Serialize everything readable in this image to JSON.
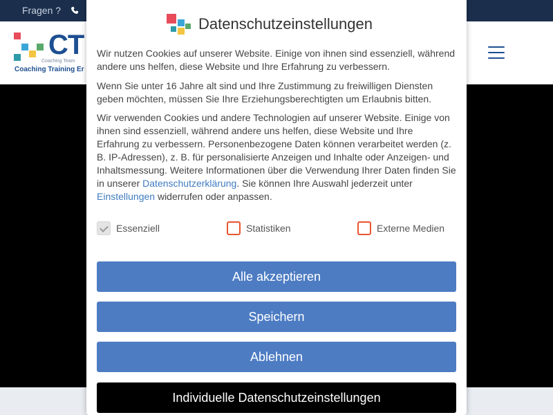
{
  "topbar": {
    "questions_label": "Fragen ?",
    "phone_icon": "phone-icon"
  },
  "header": {
    "logo": {
      "mark": "CT",
      "tagline": "Coaching Team",
      "name": "Coaching Training Er"
    },
    "menu_icon": "hamburger-menu-icon"
  },
  "modal": {
    "title": "Datenschutzeinstellungen",
    "intro": "Wir nutzen Cookies auf unserer Website. Einige von ihnen sind essenziell, während andere uns helfen, diese Website und Ihre Erfahrung zu verbessern.",
    "under16": "Wenn Sie unter 16 Jahre alt sind und Ihre Zustimmung zu freiwilligen Diensten geben möchten, müssen Sie Ihre Erziehungsberechtigten um Erlaubnis bitten.",
    "details": {
      "before_link": "Wir verwenden Cookies und andere Technologien auf unserer Website. Einige von ihnen sind essenziell, während andere uns helfen, diese Website und Ihre Erfahrung zu verbessern. Personenbezogene Daten können verarbeitet werden (z. B. IP-Adressen), z. B. für personalisierte Anzeigen und Inhalte oder Anzeigen- und Inhaltsmessung. Weitere Informationen über die Verwendung Ihrer Daten finden Sie in unserer ",
      "privacy_link": "Datenschutzerklärung",
      "middle": ". Sie können Ihre Auswahl jederzeit unter ",
      "settings_link": "Einstellungen",
      "after_link": " widerrufen oder anpassen."
    },
    "checkboxes": [
      {
        "label": "Essenziell",
        "checked": true,
        "disabled": true
      },
      {
        "label": "Statistiken",
        "checked": false,
        "disabled": false
      },
      {
        "label": "Externe Medien",
        "checked": false,
        "disabled": false
      }
    ],
    "buttons": {
      "accept_all": "Alle akzeptieren",
      "save": "Speichern",
      "reject": "Ablehnen",
      "individual": "Individuelle Datenschutzeinstellungen"
    }
  },
  "colors": {
    "topbar": "#1b2f4d",
    "brand_blue": "#1d4f91",
    "button_blue": "#4d7cc3",
    "checkbox_border": "#e8552f",
    "link": "#3f7cc0"
  }
}
